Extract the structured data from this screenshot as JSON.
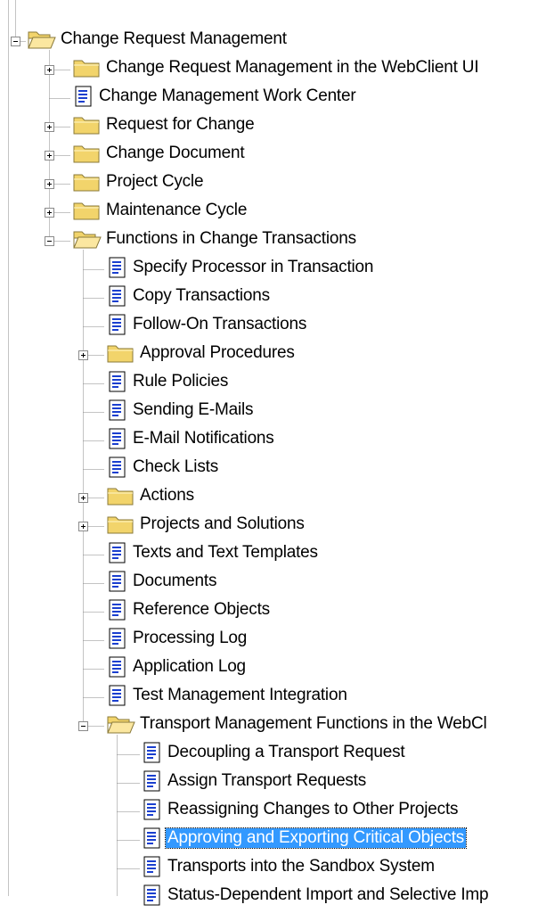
{
  "tree": {
    "nodes": [
      {
        "label": "Change Request Management",
        "level": 0,
        "type": "folder",
        "expanded": true
      },
      {
        "label": "Change Request Management in the WebClient UI",
        "level": 1,
        "type": "folder",
        "expanded": false
      },
      {
        "label": "Change Management Work Center",
        "level": 1,
        "type": "document"
      },
      {
        "label": "Request for Change",
        "level": 1,
        "type": "folder",
        "expanded": false
      },
      {
        "label": "Change Document",
        "level": 1,
        "type": "folder",
        "expanded": false
      },
      {
        "label": "Project Cycle",
        "level": 1,
        "type": "folder",
        "expanded": false
      },
      {
        "label": "Maintenance Cycle",
        "level": 1,
        "type": "folder",
        "expanded": false
      },
      {
        "label": "Functions in Change Transactions",
        "level": 1,
        "type": "folder",
        "expanded": true
      },
      {
        "label": "Specify Processor in Transaction",
        "level": 2,
        "type": "document"
      },
      {
        "label": "Copy Transactions",
        "level": 2,
        "type": "document"
      },
      {
        "label": "Follow-On Transactions",
        "level": 2,
        "type": "document"
      },
      {
        "label": "Approval Procedures",
        "level": 2,
        "type": "folder",
        "expanded": false
      },
      {
        "label": "Rule Policies",
        "level": 2,
        "type": "document"
      },
      {
        "label": "Sending E-Mails",
        "level": 2,
        "type": "document"
      },
      {
        "label": "E-Mail Notifications",
        "level": 2,
        "type": "document"
      },
      {
        "label": "Check Lists",
        "level": 2,
        "type": "document"
      },
      {
        "label": "Actions",
        "level": 2,
        "type": "folder",
        "expanded": false
      },
      {
        "label": "Projects and Solutions",
        "level": 2,
        "type": "folder",
        "expanded": false
      },
      {
        "label": "Texts and Text Templates",
        "level": 2,
        "type": "document"
      },
      {
        "label": "Documents",
        "level": 2,
        "type": "document"
      },
      {
        "label": "Reference Objects",
        "level": 2,
        "type": "document"
      },
      {
        "label": "Processing Log",
        "level": 2,
        "type": "document"
      },
      {
        "label": "Application Log",
        "level": 2,
        "type": "document"
      },
      {
        "label": "Test Management Integration",
        "level": 2,
        "type": "document"
      },
      {
        "label": "Transport Management Functions in the WebCl",
        "level": 2,
        "type": "folder",
        "expanded": true
      },
      {
        "label": "Decoupling a Transport Request",
        "level": 3,
        "type": "document"
      },
      {
        "label": "Assign Transport Requests",
        "level": 3,
        "type": "document"
      },
      {
        "label": "Reassigning Changes to Other Projects",
        "level": 3,
        "type": "document"
      },
      {
        "label": "Approving and Exporting Critical Objects",
        "level": 3,
        "type": "document",
        "selected": true
      },
      {
        "label": "Transports into the Sandbox System",
        "level": 3,
        "type": "document"
      },
      {
        "label": "Status-Dependent Import and Selective Imp",
        "level": 3,
        "type": "document"
      }
    ]
  },
  "colors": {
    "selection": "#3399ff",
    "folder": "#f2d46b",
    "document_glyph": "#1a3fcf",
    "tree_line": "#8a8a8a"
  },
  "icons": {
    "folder": "folder-icon",
    "folder_open": "folder-open-icon",
    "document": "document-icon",
    "expand": "plus-icon",
    "collapse": "minus-icon"
  }
}
